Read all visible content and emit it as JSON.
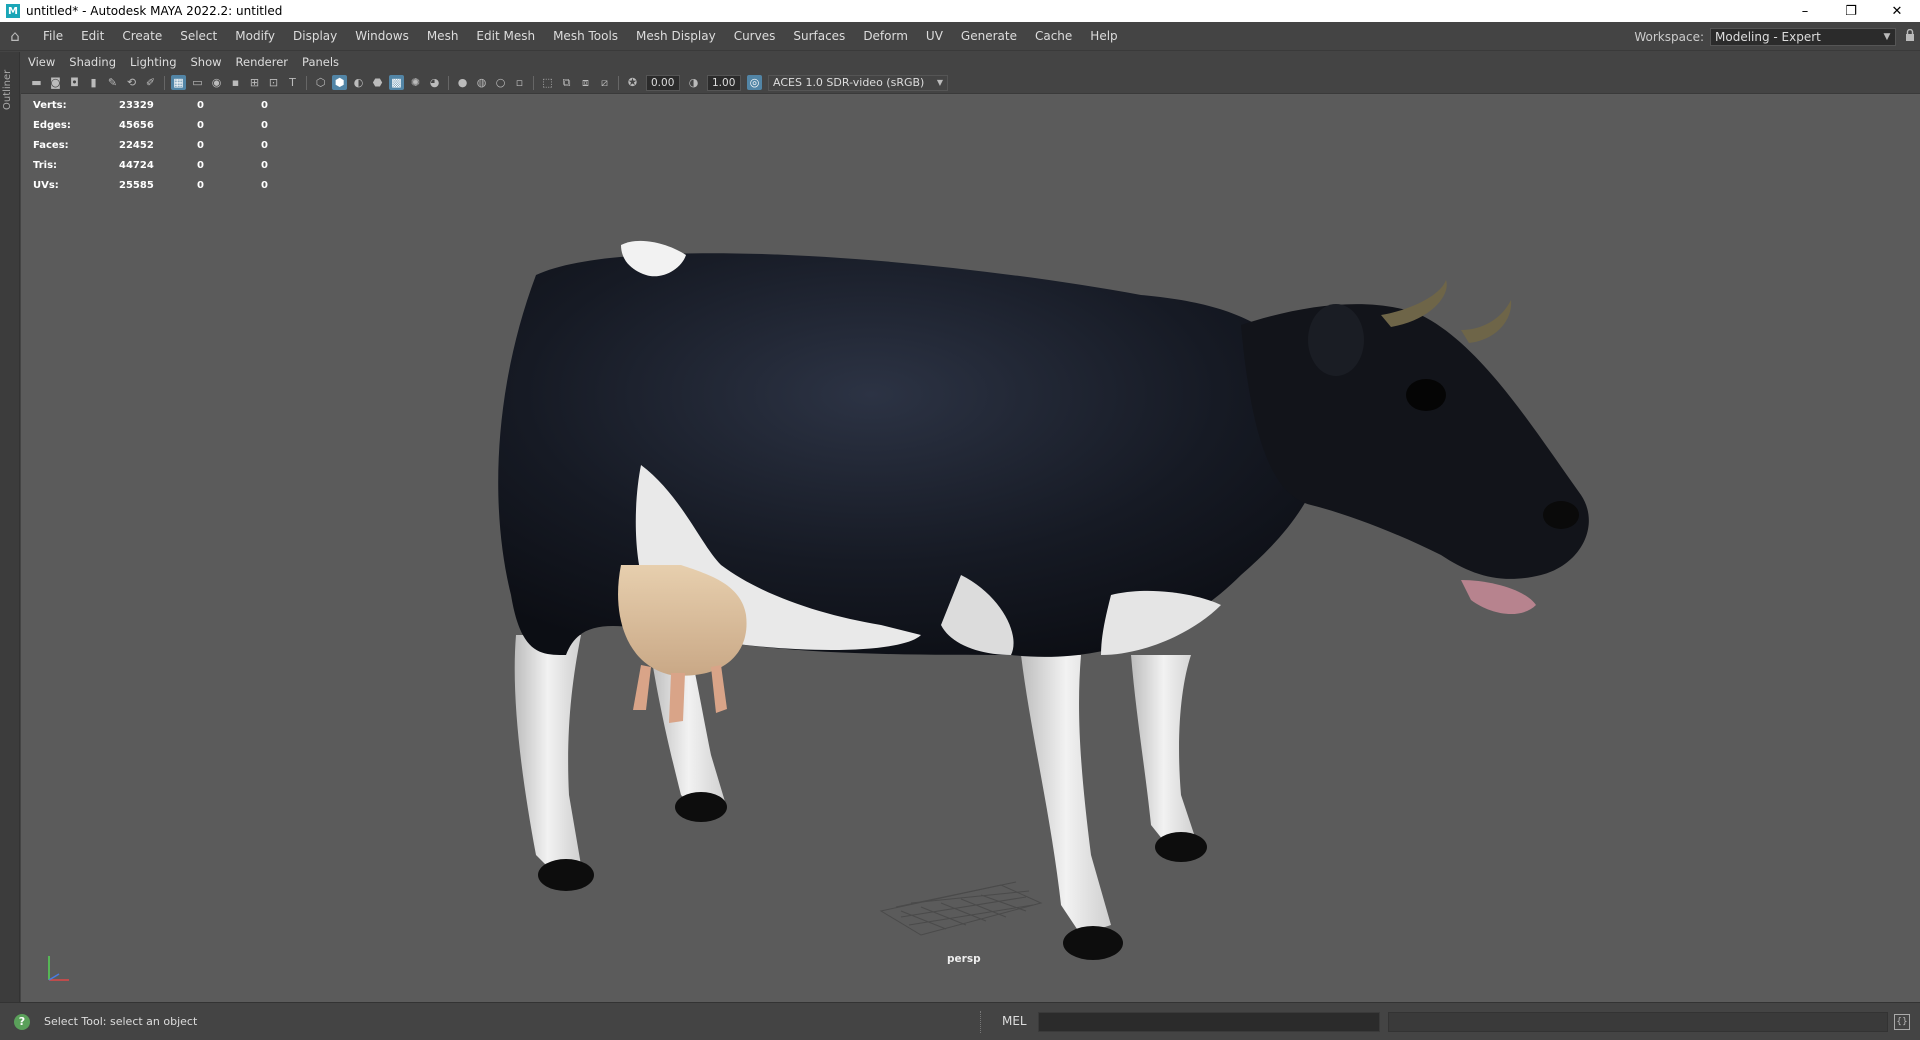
{
  "window": {
    "title": "untitled* - Autodesk MAYA 2022.2: untitled",
    "app_icon": "M",
    "minimize": "–",
    "restore": "❐",
    "close": "✕"
  },
  "menubar": {
    "home_icon": "⌂",
    "items": [
      "File",
      "Edit",
      "Create",
      "Select",
      "Modify",
      "Display",
      "Windows",
      "Mesh",
      "Edit Mesh",
      "Mesh Tools",
      "Mesh Display",
      "Curves",
      "Surfaces",
      "Deform",
      "UV",
      "Generate",
      "Cache",
      "Help"
    ],
    "workspace_label": "Workspace:",
    "workspace_value": "Modeling - Expert",
    "lock_icon": "🔒"
  },
  "outliner": {
    "label": "Outliner"
  },
  "panel": {
    "menu": [
      "View",
      "Shading",
      "Lighting",
      "Show",
      "Renderer",
      "Panels"
    ],
    "toolbar": {
      "exposure": "0.00",
      "gamma": "1.00",
      "color_space": "ACES 1.0 SDR-video (sRGB)"
    }
  },
  "hud": {
    "rows": [
      {
        "label": "Verts:",
        "v1": "23329",
        "v2": "0",
        "v3": "0"
      },
      {
        "label": "Edges:",
        "v1": "45656",
        "v2": "0",
        "v3": "0"
      },
      {
        "label": "Faces:",
        "v1": "22452",
        "v2": "0",
        "v3": "0"
      },
      {
        "label": "Tris:",
        "v1": "44724",
        "v2": "0",
        "v3": "0"
      },
      {
        "label": "UVs:",
        "v1": "25585",
        "v2": "0",
        "v3": "0"
      }
    ]
  },
  "viewport": {
    "camera": "persp"
  },
  "status": {
    "help_icon": "?",
    "help_text": "Select Tool: select an object",
    "mel_label": "MEL"
  }
}
